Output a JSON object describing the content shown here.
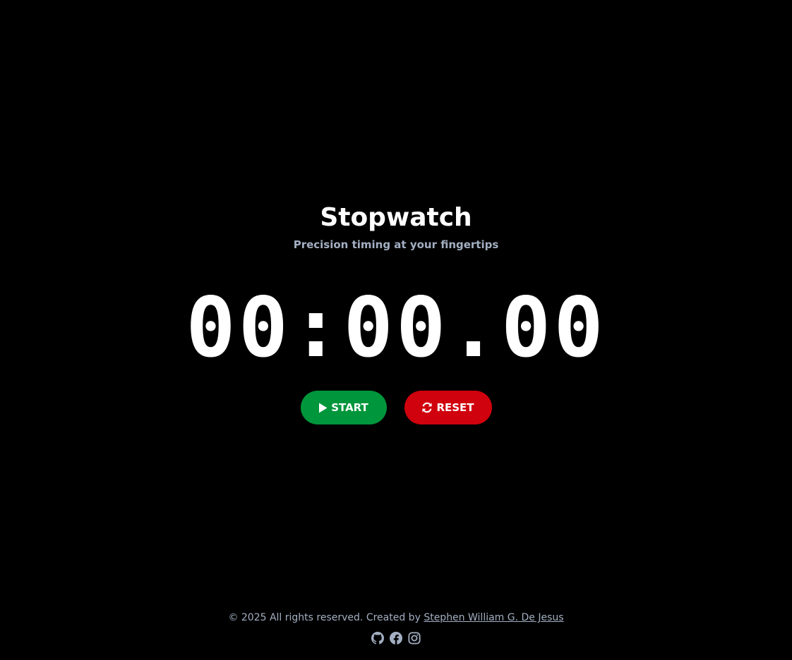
{
  "header": {
    "title": "Stopwatch",
    "subtitle": "Precision timing at your fingertips"
  },
  "timer": {
    "display": "00:00.00"
  },
  "controls": {
    "start_label": "START",
    "start_icon": "play-icon",
    "reset_label": "RESET",
    "reset_icon": "refresh-icon"
  },
  "footer": {
    "copyright_text": "© 2025 All rights reserved. Created by ",
    "author_link": "Stephen William G. De Jesus",
    "social": [
      {
        "icon": "github-icon"
      },
      {
        "icon": "facebook-icon"
      },
      {
        "icon": "instagram-icon"
      }
    ]
  },
  "colors": {
    "background": "#000000",
    "start_button": "#00963b",
    "reset_button": "#d0020d",
    "muted_text": "#a3afc2"
  }
}
